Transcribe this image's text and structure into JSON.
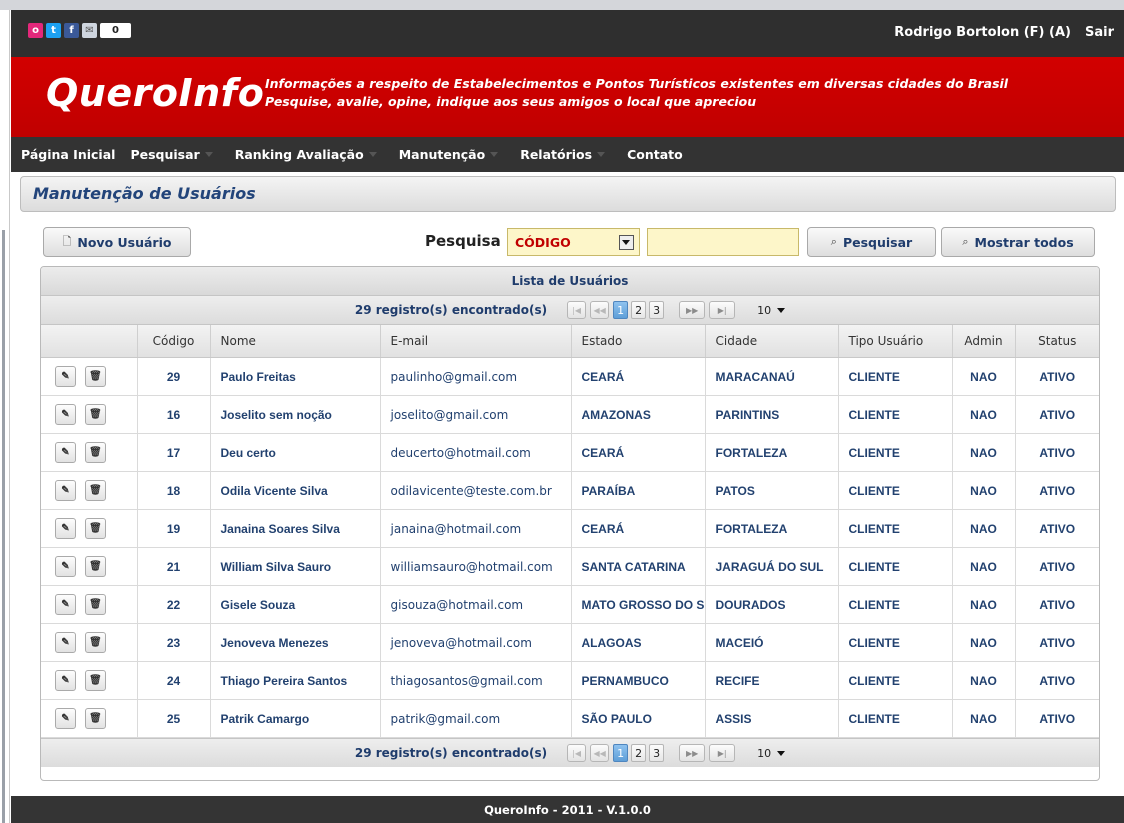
{
  "social": {
    "icons": [
      "orkut-icon",
      "twitter-icon",
      "facebook-icon",
      "mail-icon"
    ],
    "counter": "0"
  },
  "header": {
    "user": "Rodrigo Bortolon (F) (A)",
    "logout": "Sair"
  },
  "banner": {
    "logo": "QueroInfo",
    "tagline_1": "Informações a respeito de Estabelecimentos e Pontos Turísticos existentes em diversas cidades do Brasil",
    "tagline_2": "Pesquise, avalie, opine, indique aos seus amigos o local que apreciou"
  },
  "nav": [
    {
      "label": "Página Inicial",
      "dropdown": false
    },
    {
      "label": "Pesquisar",
      "dropdown": true
    },
    {
      "label": "Ranking Avaliação",
      "dropdown": true
    },
    {
      "label": "Manutenção",
      "dropdown": true
    },
    {
      "label": "Relatórios",
      "dropdown": true
    },
    {
      "label": "Contato",
      "dropdown": false
    }
  ],
  "page": {
    "title": "Manutenção de Usuários"
  },
  "toolbar": {
    "new_user": "Novo Usuário",
    "search_label": "Pesquisa",
    "search_field": "CÓDIGO",
    "search_value": "",
    "search_button": "Pesquisar",
    "show_all_button": "Mostrar todos"
  },
  "grid": {
    "caption": "Lista de Usuários",
    "records": "29 registro(s) encontrado(s)",
    "pages": [
      "1",
      "2",
      "3"
    ],
    "current_page": "1",
    "rows_per_page": "10",
    "columns": [
      "",
      "Código",
      "Nome",
      "E-mail",
      "Estado",
      "Cidade",
      "Tipo Usuário",
      "Admin",
      "Status"
    ],
    "rows": [
      {
        "codigo": "29",
        "nome": "Paulo Freitas",
        "email": "paulinho@gmail.com",
        "estado": "CEARÁ",
        "cidade": "MARACANAÚ",
        "tipo": "CLIENTE",
        "admin": "NAO",
        "status": "ATIVO"
      },
      {
        "codigo": "16",
        "nome": "Joselito sem noção",
        "email": "joselito@gmail.com",
        "estado": "AMAZONAS",
        "cidade": "PARINTINS",
        "tipo": "CLIENTE",
        "admin": "NAO",
        "status": "ATIVO"
      },
      {
        "codigo": "17",
        "nome": "Deu certo",
        "email": "deucerto@hotmail.com",
        "estado": "CEARÁ",
        "cidade": "FORTALEZA",
        "tipo": "CLIENTE",
        "admin": "NAO",
        "status": "ATIVO"
      },
      {
        "codigo": "18",
        "nome": "Odila Vicente Silva",
        "email": "odilavicente@teste.com.br",
        "estado": "PARAÍBA",
        "cidade": "PATOS",
        "tipo": "CLIENTE",
        "admin": "NAO",
        "status": "ATIVO"
      },
      {
        "codigo": "19",
        "nome": "Janaina Soares Silva",
        "email": "janaina@hotmail.com",
        "estado": "CEARÁ",
        "cidade": "FORTALEZA",
        "tipo": "CLIENTE",
        "admin": "NAO",
        "status": "ATIVO"
      },
      {
        "codigo": "21",
        "nome": "William Silva Sauro",
        "email": "williamsauro@hotmail.com",
        "estado": "SANTA CATARINA",
        "cidade": "JARAGUÁ DO SUL",
        "tipo": "CLIENTE",
        "admin": "NAO",
        "status": "ATIVO"
      },
      {
        "codigo": "22",
        "nome": "Gisele Souza",
        "email": "gisouza@hotmail.com",
        "estado": "MATO GROSSO DO S",
        "cidade": "DOURADOS",
        "tipo": "CLIENTE",
        "admin": "NAO",
        "status": "ATIVO"
      },
      {
        "codigo": "23",
        "nome": "Jenoveva Menezes",
        "email": "jenoveva@hotmail.com",
        "estado": "ALAGOAS",
        "cidade": "MACEIÓ",
        "tipo": "CLIENTE",
        "admin": "NAO",
        "status": "ATIVO"
      },
      {
        "codigo": "24",
        "nome": "Thiago Pereira Santos",
        "email": "thiagosantos@gmail.com",
        "estado": "PERNAMBUCO",
        "cidade": "RECIFE",
        "tipo": "CLIENTE",
        "admin": "NAO",
        "status": "ATIVO"
      },
      {
        "codigo": "25",
        "nome": "Patrik Camargo",
        "email": "patrik@gmail.com",
        "estado": "SÃO PAULO",
        "cidade": "ASSIS",
        "tipo": "CLIENTE",
        "admin": "NAO",
        "status": "ATIVO"
      }
    ]
  },
  "footer": {
    "text": "QueroInfo - 2011 - V.1.0.0"
  },
  "colors": {
    "banner_red": "#cc0000",
    "topbar": "#2f2f2f",
    "nav": "#333333",
    "title_blue": "#22447a",
    "cell_text": "#22416f",
    "search_field_bg": "#fdf6c9",
    "active_page": "#5e9fd8"
  }
}
